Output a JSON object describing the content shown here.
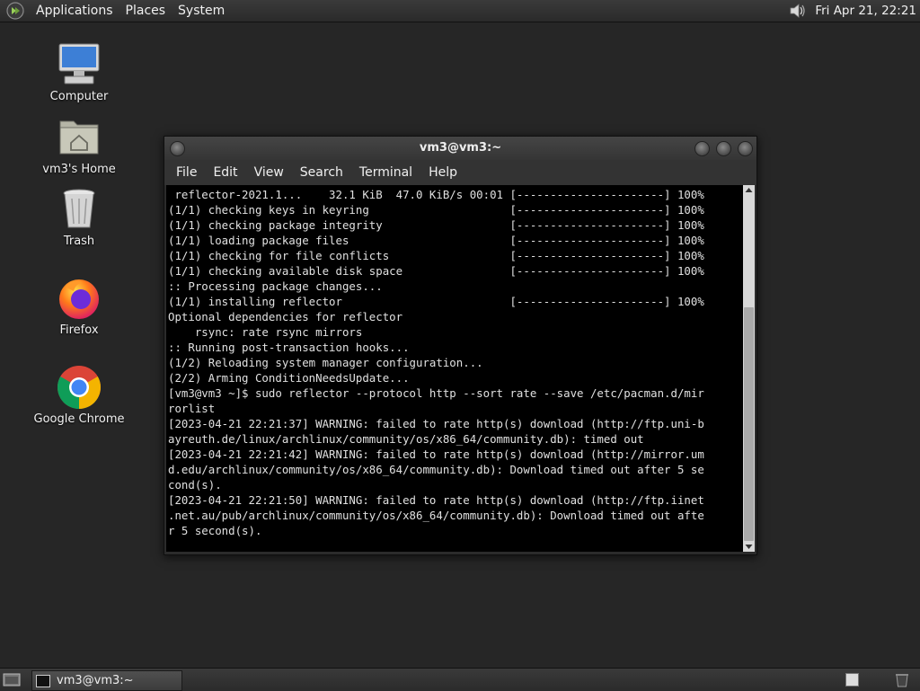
{
  "top_panel": {
    "menus": [
      "Applications",
      "Places",
      "System"
    ],
    "clock": "Fri Apr 21, 22:21"
  },
  "desktop_icons": [
    {
      "label": "Computer",
      "icon": "computer-icon"
    },
    {
      "label": "vm3's Home",
      "icon": "home-folder-icon"
    },
    {
      "label": "Trash",
      "icon": "trash-icon"
    },
    {
      "label": "Firefox",
      "icon": "firefox-icon"
    },
    {
      "label": "Google Chrome",
      "icon": "chrome-icon"
    }
  ],
  "terminal": {
    "title": "vm3@vm3:~",
    "menu": [
      "File",
      "Edit",
      "View",
      "Search",
      "Terminal",
      "Help"
    ],
    "lines": [
      " reflector-2021.1...    32.1 KiB  47.0 KiB/s 00:01 [----------------------] 100%",
      "(1/1) checking keys in keyring                     [----------------------] 100%",
      "(1/1) checking package integrity                   [----------------------] 100%",
      "(1/1) loading package files                        [----------------------] 100%",
      "(1/1) checking for file conflicts                  [----------------------] 100%",
      "(1/1) checking available disk space                [----------------------] 100%",
      ":: Processing package changes...",
      "(1/1) installing reflector                         [----------------------] 100%",
      "Optional dependencies for reflector",
      "    rsync: rate rsync mirrors",
      ":: Running post-transaction hooks...",
      "(1/2) Reloading system manager configuration...",
      "(2/2) Arming ConditionNeedsUpdate...",
      "[vm3@vm3 ~]$ sudo reflector --protocol http --sort rate --save /etc/pacman.d/mir",
      "rorlist",
      "[2023-04-21 22:21:37] WARNING: failed to rate http(s) download (http://ftp.uni-b",
      "ayreuth.de/linux/archlinux/community/os/x86_64/community.db): timed out",
      "[2023-04-21 22:21:42] WARNING: failed to rate http(s) download (http://mirror.um",
      "d.edu/archlinux/community/os/x86_64/community.db): Download timed out after 5 se",
      "cond(s).",
      "[2023-04-21 22:21:50] WARNING: failed to rate http(s) download (http://ftp.iinet",
      ".net.au/pub/archlinux/community/os/x86_64/community.db): Download timed out afte",
      "r 5 second(s)."
    ]
  },
  "taskbar": {
    "window_button": "vm3@vm3:~"
  }
}
